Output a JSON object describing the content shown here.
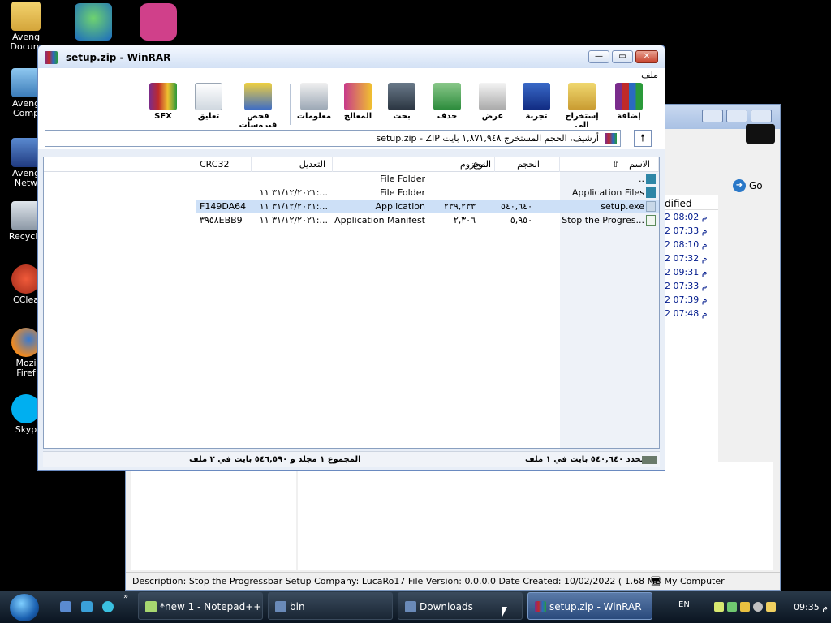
{
  "desktop": {
    "icons": [
      {
        "label": "Aveng",
        "label2": "Docum",
        "icon": "documents-folder-icon"
      },
      {
        "label": "Aveng",
        "label2": "Comp",
        "icon": "computer-icon"
      },
      {
        "label": "Aveng",
        "label2": "Netw",
        "icon": "network-icon"
      },
      {
        "label": "Recycle",
        "label2": "",
        "icon": "recycle-bin-icon"
      },
      {
        "label": "CClea",
        "label2": "",
        "icon": "ccleaner-icon"
      },
      {
        "label": "Mozi",
        "label2": "Firef",
        "icon": "firefox-icon"
      },
      {
        "label": "Skyp",
        "label2": "",
        "icon": "skype-icon"
      }
    ]
  },
  "explorer": {
    "go_label": "Go",
    "modified_header": "dified",
    "modified_rows": [
      "2 08:02 م",
      "2 07:33 م",
      "2 08:10 م",
      "2 07:32 م",
      "2 09:31 م",
      "2 07:33 م",
      "2 07:39 م",
      "2 07:48 م"
    ],
    "status_text": "Description: Stop the Progressbar Setup Company: LucaRo17 File Version: 0.0.0.0 Date Created: 10/02/2022 ( 1.68 MB",
    "status_right": "My Computer"
  },
  "winrar": {
    "title": "setup.zip - WinRAR",
    "menu_label": "ملف",
    "toolbar": [
      {
        "label": "إضافة",
        "icon": "add-archive-icon"
      },
      {
        "label": "إستخراج إلى",
        "icon": "extract-to-icon"
      },
      {
        "label": "تجربة",
        "icon": "test-icon"
      },
      {
        "label": "عرض",
        "icon": "view-icon"
      },
      {
        "label": "حذف",
        "icon": "delete-icon"
      },
      {
        "label": "بحث",
        "icon": "find-icon"
      },
      {
        "label": "المعالج",
        "icon": "wizard-icon"
      },
      {
        "label": "معلومات",
        "icon": "info-icon"
      },
      {
        "label": "فحص فيروسات",
        "icon": "virus-scan-icon"
      },
      {
        "label": "تعليق",
        "icon": "comment-icon"
      },
      {
        "label": "SFX",
        "icon": "sfx-icon"
      }
    ],
    "path_text": "setup.zip - ZIP أرشيف، الحجم المستخرج ١,٨٧١,٩٤٨ بايت",
    "columns": {
      "name": "الاسم",
      "size": "الحجم",
      "packed": "المحزوم",
      "type": "النوع",
      "modified": "التعديل",
      "crc": "CRC32"
    },
    "files": [
      {
        "name": "..",
        "size": "",
        "packed": "",
        "type": "File Folder",
        "modified": "",
        "crc": "",
        "icon": "folder",
        "selected": false
      },
      {
        "name": "Application Files",
        "size": "",
        "packed": "",
        "type": "File Folder",
        "modified": "٣١/١٢/٢٠٢١ ١١:...",
        "crc": "",
        "icon": "folder",
        "selected": false
      },
      {
        "name": "setup.exe",
        "size": "٥٤٠,٦٤٠",
        "packed": "٢٣٩,٢٣٣",
        "type": "Application",
        "modified": "٣١/١٢/٢٠٢١ ١١:...",
        "crc": "F149DA64",
        "icon": "exe",
        "selected": true
      },
      {
        "name": "Stop the Progres...",
        "size": "٥,٩٥٠",
        "packed": "٢,٣٠٦",
        "type": "Application Manifest",
        "modified": "٣١/١٢/٢٠٢١ ١١:...",
        "crc": "٣٩٥٨EBB9",
        "icon": "man",
        "selected": false
      }
    ],
    "status_left": "المجموع ١ مجلد و ٥٤٦,٥٩٠ بايت في ٢ ملف",
    "status_right": "محدد ٥٤٠,٦٤٠ بايت في ١ ملف"
  },
  "taskbar": {
    "tasks": [
      {
        "label": "*new 1 - Notepad++",
        "active": false
      },
      {
        "label": "bin",
        "active": false
      },
      {
        "label": "Downloads",
        "active": false
      },
      {
        "label": "setup.zip - WinRAR",
        "active": true
      }
    ],
    "lang": "EN",
    "clock": "09:35 م"
  },
  "colors": {
    "accent": "#316ac5",
    "selection": "#cde0f7",
    "taskbar": "#1a2634"
  }
}
